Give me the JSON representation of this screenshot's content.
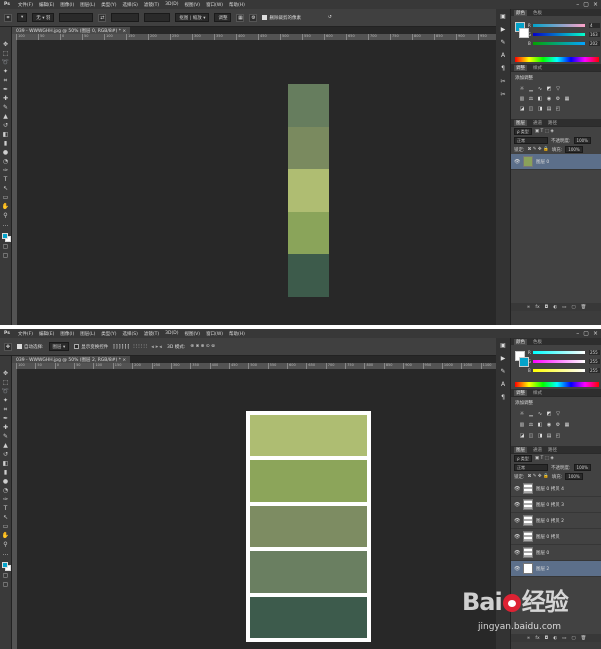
{
  "top": {
    "menu": [
      "文件(F)",
      "编辑(E)",
      "图像(I)",
      "图层(L)",
      "类型(Y)",
      "选择(S)",
      "滤镜(T)",
      "3D(D)",
      "视图(V)",
      "窗口(W)",
      "帮助(H)"
    ],
    "options": {
      "tool_preset": "▾",
      "mode_select": "无 ▾ 羽",
      "width_field": "",
      "height_field": "",
      "style_label": "抠图 | 缩放 ▾",
      "refine_label": "调整",
      "delete_checkbox_label": "删除裁剪的像素",
      "reset_icon": "↺"
    },
    "doc_tab": "039 - WWWGHH.jpg @ 50% (图层 0, RGB/8#) * ×",
    "ruler_ticks": [
      "100",
      "50",
      "0",
      "50",
      "100",
      "150",
      "200",
      "250",
      "300",
      "350",
      "400",
      "450",
      "500",
      "550",
      "600",
      "650",
      "700",
      "750",
      "800",
      "850",
      "900",
      "950"
    ],
    "swatches": [
      "#667d5e",
      "#7a8a5f",
      "#afbd72",
      "#8aa45a",
      "#3d5b4b"
    ],
    "color_panel": {
      "tabs": [
        "颜色",
        "色板"
      ],
      "R": "4",
      "G": "163",
      "B": "202",
      "fg": "#04a3ca"
    },
    "adjust_panel": {
      "tabs": [
        "调整",
        "样式"
      ],
      "title": "添加调整"
    },
    "layers_panel": {
      "tabs": [
        "图层",
        "通道",
        "路径"
      ],
      "kind": "ρ 类型",
      "blend": "正常",
      "opacity_label": "不透明度:",
      "opacity": "100%",
      "lock_label": "锁定:",
      "fill_label": "填充:",
      "fill": "100%",
      "layers": [
        {
          "name": "图层 0",
          "active": true
        }
      ]
    }
  },
  "bottom": {
    "menu": [
      "文件(F)",
      "编辑(E)",
      "图像(I)",
      "图层(L)",
      "类型(Y)",
      "选择(S)",
      "滤镜(T)",
      "3D(D)",
      "视图(V)",
      "窗口(W)",
      "帮助(H)"
    ],
    "options": {
      "auto_select_label": "自动选择:",
      "auto_select_value": "图层 ▾",
      "transform_label": "显示变换控件",
      "mode_3d": "3D 模式:"
    },
    "doc_tab": "039 - WWWGHH.jpg @ 50% (图层 2, RGB/8#) * ×",
    "ruler_ticks": [
      "100",
      "50",
      "0",
      "50",
      "100",
      "150",
      "200",
      "250",
      "300",
      "350",
      "400",
      "450",
      "500",
      "550",
      "600",
      "650",
      "700",
      "750",
      "800",
      "850",
      "900",
      "950",
      "1000",
      "1050",
      "1100"
    ],
    "swatches": [
      "#aebd72",
      "#8ca55a",
      "#7d8c62",
      "#6a7f61",
      "#3d5b4c"
    ],
    "color_panel": {
      "tabs": [
        "颜色",
        "色板"
      ],
      "R": "255",
      "G": "255",
      "B": "255",
      "fg": "#ffffff"
    },
    "adjust_panel": {
      "tabs": [
        "调整",
        "样式"
      ],
      "title": "添加调整"
    },
    "layers_panel": {
      "tabs": [
        "图层",
        "通道",
        "路径"
      ],
      "kind": "ρ 类型",
      "blend": "正常",
      "opacity_label": "不透明度:",
      "opacity": "100%",
      "lock_label": "锁定:",
      "fill_label": "填充:",
      "fill": "100%",
      "layers": [
        {
          "name": "图层 0 拷贝 4",
          "active": false,
          "thumb": "stripes"
        },
        {
          "name": "图层 0 拷贝 3",
          "active": false,
          "thumb": "stripes"
        },
        {
          "name": "图层 0 拷贝 2",
          "active": false,
          "thumb": "stripes"
        },
        {
          "name": "图层 0 拷贝",
          "active": false,
          "thumb": "stripes"
        },
        {
          "name": "图层 0",
          "active": false,
          "thumb": "stripes"
        },
        {
          "name": "图层 2",
          "active": true,
          "thumb": "white"
        }
      ]
    }
  },
  "watermark": {
    "logo_a": "Bai",
    "logo_b": "经验",
    "url": "jingyan.baidu.com"
  },
  "ps_logo": "Ps"
}
